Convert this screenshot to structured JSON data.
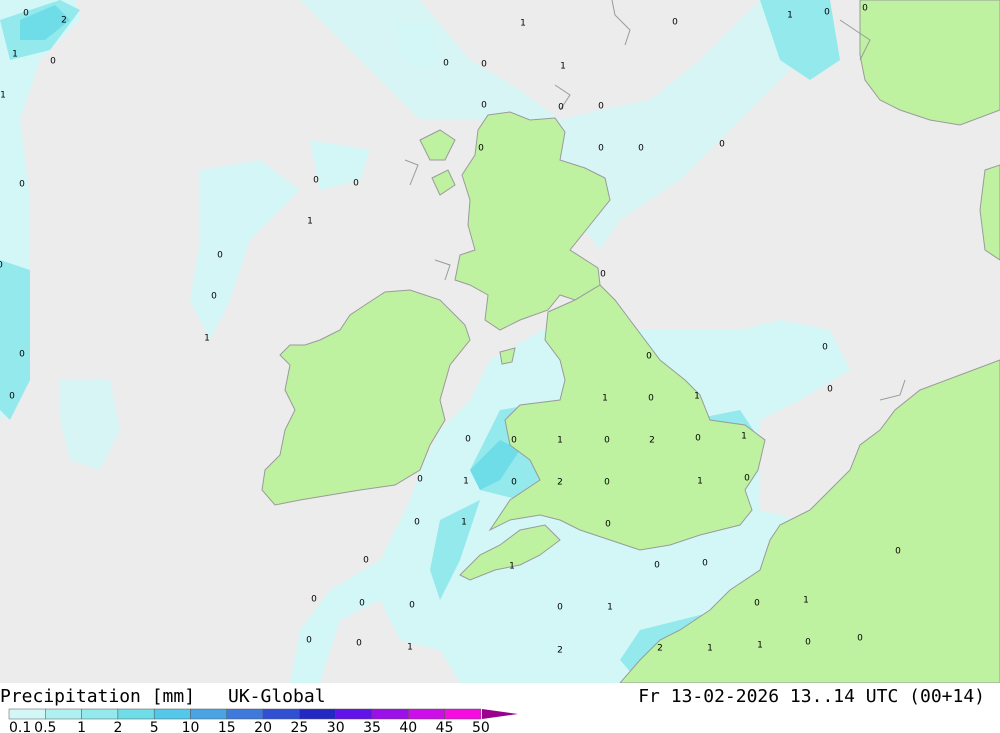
{
  "product": {
    "title": "Precipitation [mm]",
    "model": "UK-Global",
    "valid_time": "Fr 13-02-2026 13..14 UTC (00+14)"
  },
  "legend": {
    "labels": [
      "0.1",
      "0.5",
      "1",
      "2",
      "5",
      "10",
      "15",
      "20",
      "25",
      "30",
      "35",
      "40",
      "45",
      "50"
    ],
    "colors": [
      "#d3f7f7",
      "#b1f0f0",
      "#93e9ec",
      "#6fdde8",
      "#55c8ea",
      "#4aa3e3",
      "#3f79dc",
      "#304fd3",
      "#2228c0",
      "#6014e8",
      "#9b10e8",
      "#cc0ee8",
      "#f50ce0",
      "#c800a6",
      "#9a008c"
    ]
  },
  "colors": {
    "sea": "#ececec",
    "land": "#bff2a0",
    "coast": "#9a9a9a"
  },
  "map_labels": [
    {
      "v": "0"
    },
    {
      "v": "2"
    },
    {
      "v": "1"
    },
    {
      "v": "0"
    },
    {
      "v": "1"
    },
    {
      "v": "0"
    },
    {
      "v": "0"
    },
    {
      "v": "0"
    },
    {
      "v": "1"
    },
    {
      "v": "0"
    },
    {
      "v": "1"
    },
    {
      "v": "0"
    },
    {
      "v": "0"
    },
    {
      "v": "0"
    },
    {
      "v": "0"
    },
    {
      "v": "1"
    },
    {
      "v": "1"
    },
    {
      "v": "0"
    },
    {
      "v": "0"
    },
    {
      "v": "1"
    },
    {
      "v": "0"
    },
    {
      "v": "0"
    },
    {
      "v": "0"
    },
    {
      "v": "0"
    },
    {
      "v": "0"
    },
    {
      "v": "0"
    },
    {
      "v": "0"
    },
    {
      "v": "0"
    },
    {
      "v": "0"
    },
    {
      "v": "0"
    },
    {
      "v": "0"
    },
    {
      "v": "0"
    },
    {
      "v": "1"
    },
    {
      "v": "0"
    },
    {
      "v": "1"
    },
    {
      "v": "0"
    },
    {
      "v": "0"
    },
    {
      "v": "0"
    },
    {
      "v": "0"
    },
    {
      "v": "1"
    },
    {
      "v": "0"
    },
    {
      "v": "2"
    },
    {
      "v": "0"
    },
    {
      "v": "1"
    },
    {
      "v": "1"
    },
    {
      "v": "0"
    },
    {
      "v": "2"
    },
    {
      "v": "0"
    },
    {
      "v": "1"
    },
    {
      "v": "0"
    },
    {
      "v": "1"
    },
    {
      "v": "0"
    },
    {
      "v": "0"
    },
    {
      "v": "0"
    },
    {
      "v": "0"
    },
    {
      "v": "1"
    },
    {
      "v": "0"
    },
    {
      "v": "0"
    },
    {
      "v": "0"
    },
    {
      "v": "0"
    },
    {
      "v": "0"
    },
    {
      "v": "0"
    },
    {
      "v": "0"
    },
    {
      "v": "1"
    },
    {
      "v": "0"
    },
    {
      "v": "1"
    },
    {
      "v": "1"
    },
    {
      "v": "2"
    },
    {
      "v": "2"
    },
    {
      "v": "1"
    },
    {
      "v": "1"
    },
    {
      "v": "0"
    },
    {
      "v": "0"
    },
    {
      "v": "0"
    },
    {
      "v": "0"
    }
  ]
}
